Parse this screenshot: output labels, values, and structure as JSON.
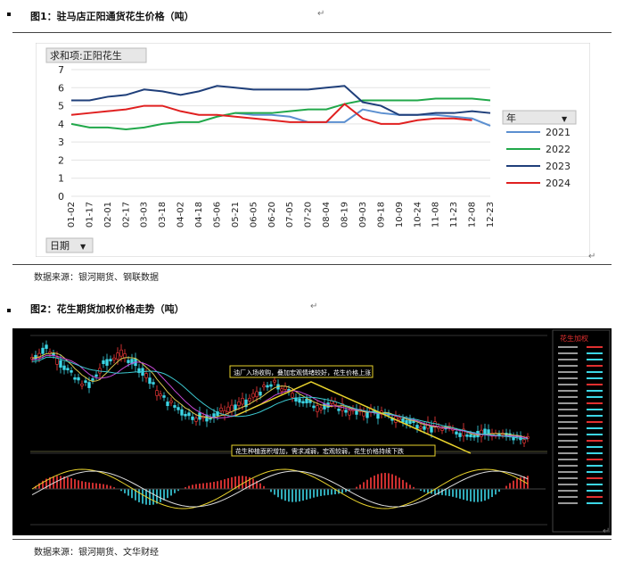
{
  "fig1": {
    "title": "图1：驻马店正阳通货花生价格（吨）",
    "source": "数据来源：银河期货、钢联数据",
    "chart_data": {
      "type": "line",
      "title_button": "求和项:正阳花生",
      "x_button": "日期",
      "legend_button": "年",
      "ylim": [
        0,
        7
      ],
      "yticks": [
        0,
        1,
        2,
        3,
        4,
        5,
        6,
        7
      ],
      "xtick_labels": [
        "01-02",
        "01-17",
        "02-01",
        "02-17",
        "03-03",
        "03-18",
        "04-02",
        "04-18",
        "05-06",
        "05-21",
        "06-05",
        "06-20",
        "07-05",
        "07-20",
        "08-04",
        "08-19",
        "09-03",
        "09-18",
        "10-09",
        "10-24",
        "11-08",
        "11-23",
        "12-08",
        "12-23"
      ],
      "series": [
        {
          "name": "2021",
          "color": "#5b8fd0",
          "values": [
            null,
            null,
            null,
            null,
            null,
            null,
            null,
            null,
            null,
            4.6,
            4.5,
            4.5,
            4.4,
            4.1,
            4.1,
            4.1,
            4.8,
            4.6,
            4.5,
            4.5,
            4.5,
            4.4,
            4.3,
            3.9
          ]
        },
        {
          "name": "2022",
          "color": "#21a84a",
          "values": [
            4.0,
            3.8,
            3.8,
            3.7,
            3.8,
            4.0,
            4.1,
            4.1,
            4.4,
            4.6,
            4.6,
            4.6,
            4.7,
            4.8,
            4.8,
            5.1,
            5.3,
            5.3,
            5.3,
            5.3,
            5.4,
            5.4,
            5.4,
            5.3
          ]
        },
        {
          "name": "2023",
          "color": "#1f3f7a",
          "values": [
            5.3,
            5.3,
            5.5,
            5.6,
            5.9,
            5.8,
            5.6,
            5.8,
            6.1,
            6.0,
            5.9,
            5.9,
            5.9,
            5.9,
            6.0,
            6.1,
            5.2,
            5.0,
            4.5,
            4.5,
            4.6,
            4.6,
            4.7,
            4.6
          ]
        },
        {
          "name": "2024",
          "color": "#e02020",
          "values": [
            4.5,
            4.6,
            4.7,
            4.8,
            5.0,
            5.0,
            4.7,
            4.5,
            4.5,
            4.4,
            4.3,
            4.2,
            4.1,
            4.1,
            4.1,
            5.1,
            4.3,
            4.0,
            4.0,
            4.2,
            4.3,
            4.3,
            4.2,
            null
          ]
        }
      ]
    }
  },
  "fig2": {
    "title": "图2：花生期货加权价格走势（吨）",
    "source": "数据来源：银河期货、文华财经",
    "annotation_top": "油厂入场收购，叠加宏观情绪较好，花生价格上涨",
    "annotation_bottom": "花生种植面积增加，需求减弱，宏观较弱，花生价格持续下跌",
    "panel_title": "花生加权",
    "chart_data": {
      "type": "line",
      "series": [
        {
          "name": "",
          "color": "#e6e6e6",
          "values": [
            10100,
            10400,
            10000,
            9500,
            9300,
            9900,
            10200,
            10050,
            9600,
            9000,
            8700,
            8450,
            8350,
            8500,
            8650,
            8800,
            9150,
            9350,
            9100,
            8850,
            8700,
            8750,
            8600,
            8500,
            8550,
            8400,
            8300,
            8200,
            8100,
            8050,
            7950,
            7900,
            7950,
            7850,
            7800,
            7750
          ]
        }
      ]
    }
  },
  "watermark": "↵"
}
